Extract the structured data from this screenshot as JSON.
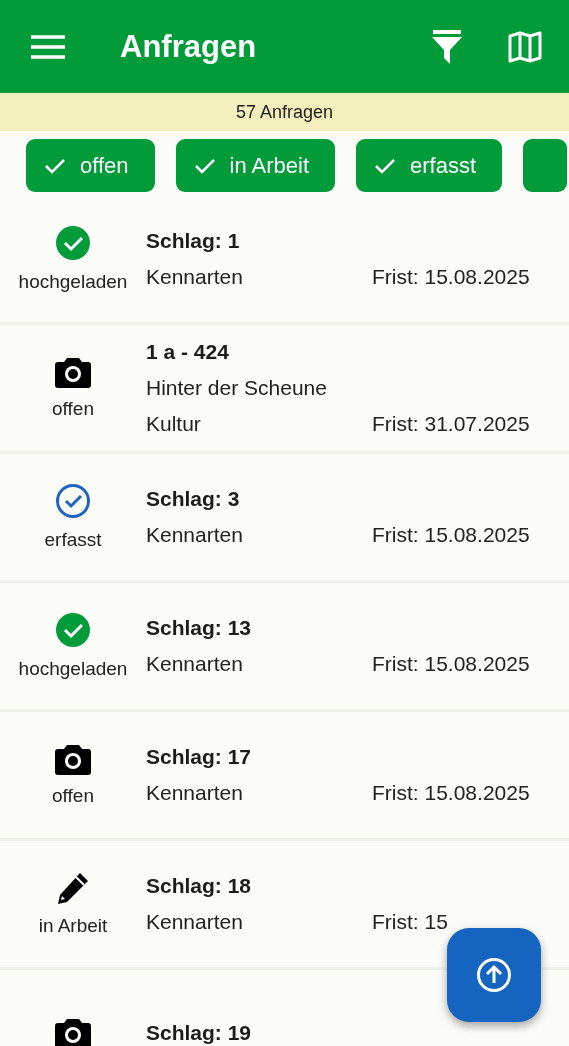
{
  "app_bar": {
    "title": "Anfragen"
  },
  "count_banner": "57 Anfragen",
  "filter_chips": [
    {
      "label": "offen",
      "selected": true
    },
    {
      "label": "in Arbeit",
      "selected": true
    },
    {
      "label": "erfasst",
      "selected": true
    },
    {
      "selected": true
    }
  ],
  "requests": [
    {
      "kind": "uploaded",
      "status": "hochgeladen",
      "title": "Schlag: 1",
      "lines": [
        "Kennarten"
      ],
      "deadline": "Frist: 15.08.2025"
    },
    {
      "kind": "open",
      "status": "offen",
      "title": "1 a - 424",
      "lines": [
        "Hinter der Scheune",
        "Kultur"
      ],
      "deadline": "Frist: 31.07.2025"
    },
    {
      "kind": "captured",
      "status": "erfasst",
      "title": "Schlag: 3",
      "lines": [
        "Kennarten"
      ],
      "deadline": "Frist: 15.08.2025"
    },
    {
      "kind": "uploaded",
      "status": "hochgeladen",
      "title": "Schlag: 13",
      "lines": [
        "Kennarten"
      ],
      "deadline": "Frist: 15.08.2025"
    },
    {
      "kind": "open",
      "status": "offen",
      "title": "Schlag: 17",
      "lines": [
        "Kennarten"
      ],
      "deadline": "Frist: 15.08.2025"
    },
    {
      "kind": "in_progress",
      "status": "in Arbeit",
      "title": "Schlag: 18",
      "lines": [
        "Kennarten"
      ],
      "deadline": "Frist: 15"
    },
    {
      "kind": "open",
      "title": "Schlag: 19"
    }
  ]
}
